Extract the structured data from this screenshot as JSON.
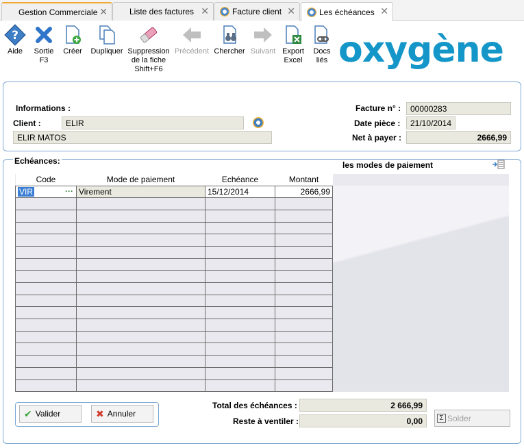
{
  "tabs": [
    {
      "label": "Gestion Commerciale"
    },
    {
      "label": "Liste des factures"
    },
    {
      "label": "Facture client"
    },
    {
      "label": "Les échéances"
    }
  ],
  "toolbar": {
    "aide": "Aide",
    "sortie": "Sortie\nF3",
    "creer": "Créer",
    "dupliquer": "Dupliquer",
    "suppression": "Suppression\nde la fiche\nShift+F6",
    "precedent": "Précédent",
    "chercher": "Chercher",
    "suivant": "Suivant",
    "export": "Export\nExcel",
    "docs": "Docs\nliés"
  },
  "logo": "oxygène",
  "informations": {
    "title": "Informations :",
    "client_label": "Client :",
    "client_code": "ELIR",
    "client_name": "ELIR MATOS",
    "facture_label": "Facture n° :",
    "facture_value": "00000283",
    "date_label": "Date pièce :",
    "date_value": "21/10/2014",
    "net_label": "Net à payer :",
    "net_value": "2666,99"
  },
  "echeances": {
    "title": "Echéances:",
    "modes_title": "les modes de paiement",
    "columns": [
      "Code",
      "Mode de paiement",
      "Echéance",
      "Montant"
    ],
    "rows": [
      {
        "code": "VIR",
        "mode": "Virement",
        "echeance": "15/12/2014",
        "montant": "2666,99"
      }
    ]
  },
  "actions": {
    "valider": "Valider",
    "annuler": "Annuler"
  },
  "totals": {
    "total_label": "Total des échéances :",
    "total_value": "2 666,99",
    "reste_label": "Reste à ventiler :",
    "reste_value": "0,00",
    "solder": "Solder"
  },
  "colors": {
    "accent": "#1596c8",
    "panel_border": "#7ba7d1",
    "field_bg": "#e9e9df",
    "selection": "#3b7fd4"
  }
}
